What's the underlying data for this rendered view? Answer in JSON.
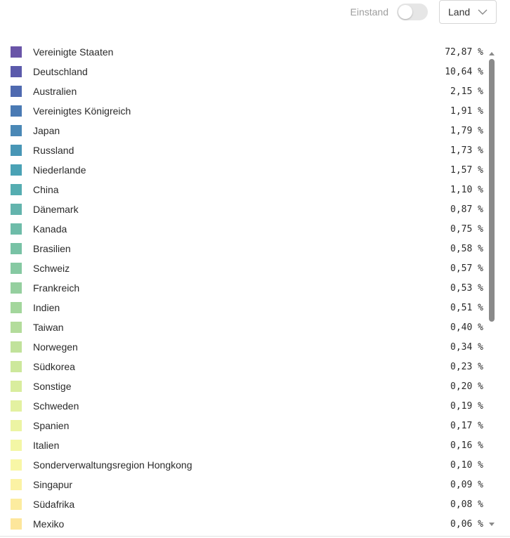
{
  "controls": {
    "toggle_label": "Einstand",
    "toggle_on": false,
    "select_value": "Land"
  },
  "icons": {
    "chevron": "chevron-down-icon",
    "scroll_up": "triangle-up-icon",
    "scroll_down": "triangle-down-icon"
  },
  "list": [
    {
      "name": "Vereinigte Staaten",
      "value": "72,87 %",
      "color": "#6a55a8"
    },
    {
      "name": "Deutschland",
      "value": "10,64 %",
      "color": "#5b5aab"
    },
    {
      "name": "Australien",
      "value": "2,15 %",
      "color": "#4f6ab0"
    },
    {
      "name": "Vereinigtes Königreich",
      "value": "1,91 %",
      "color": "#4a7ab4"
    },
    {
      "name": "Japan",
      "value": "1,79 %",
      "color": "#4a88b6"
    },
    {
      "name": "Russland",
      "value": "1,73 %",
      "color": "#4896b6"
    },
    {
      "name": "Niederlande",
      "value": "1,57 %",
      "color": "#4aa2b5"
    },
    {
      "name": "China",
      "value": "1,10 %",
      "color": "#55adb1"
    },
    {
      "name": "Dänemark",
      "value": "0,87 %",
      "color": "#63b4ad"
    },
    {
      "name": "Kanada",
      "value": "0,75 %",
      "color": "#6ebca9"
    },
    {
      "name": "Brasilien",
      "value": "0,58 %",
      "color": "#78c2a5"
    },
    {
      "name": "Schweiz",
      "value": "0,57 %",
      "color": "#86c9a2"
    },
    {
      "name": "Frankreich",
      "value": "0,53 %",
      "color": "#95cf9f"
    },
    {
      "name": "Indien",
      "value": "0,51 %",
      "color": "#a3d69c"
    },
    {
      "name": "Taiwan",
      "value": "0,40 %",
      "color": "#b3dc9b"
    },
    {
      "name": "Norwegen",
      "value": "0,34 %",
      "color": "#c1e29b"
    },
    {
      "name": "Südkorea",
      "value": "0,23 %",
      "color": "#cde89c"
    },
    {
      "name": "Sonstige",
      "value": "0,20 %",
      "color": "#d9ed9e"
    },
    {
      "name": "Schweden",
      "value": "0,19 %",
      "color": "#e3f1a1"
    },
    {
      "name": "Spanien",
      "value": "0,17 %",
      "color": "#ecf4a3"
    },
    {
      "name": "Italien",
      "value": "0,16 %",
      "color": "#f3f6a5"
    },
    {
      "name": "Sonderverwaltungsregion Hongkong",
      "value": "0,10 %",
      "color": "#f8f6a6"
    },
    {
      "name": "Singapur",
      "value": "0,09 %",
      "color": "#fbf2a4"
    },
    {
      "name": "Südafrika",
      "value": "0,08 %",
      "color": "#fcec9f"
    },
    {
      "name": "Mexiko",
      "value": "0,06 %",
      "color": "#fde69b"
    }
  ]
}
